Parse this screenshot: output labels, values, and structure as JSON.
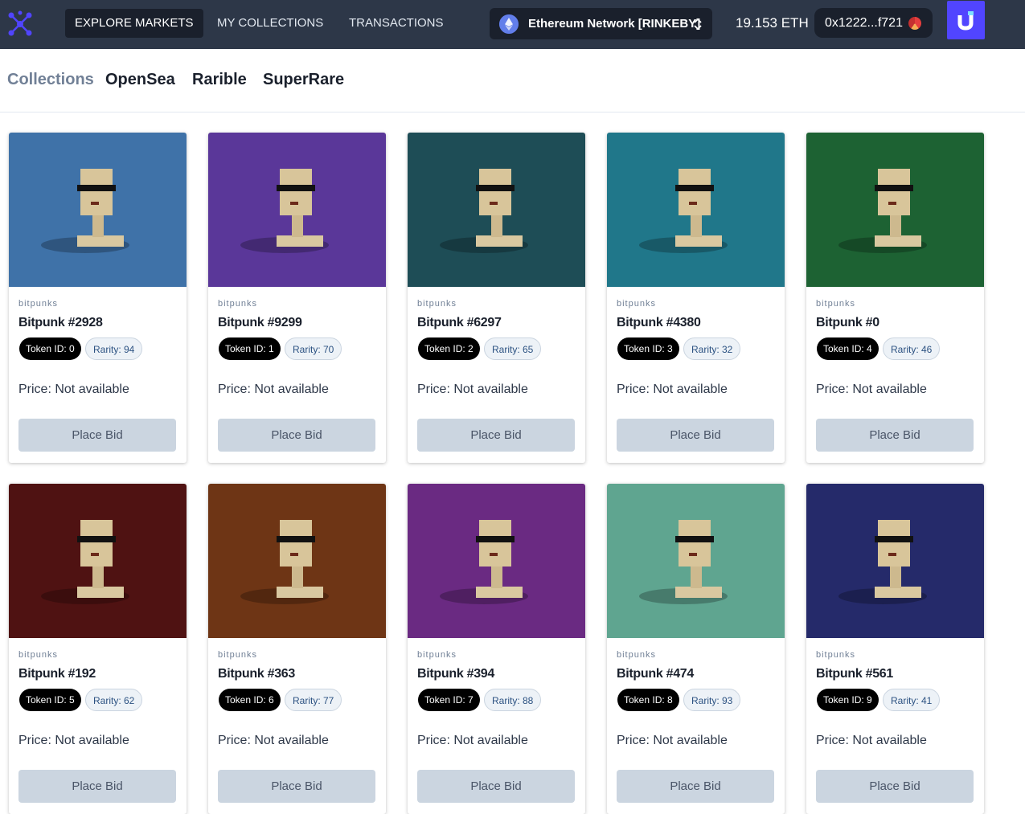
{
  "nav": {
    "links": [
      "EXPLORE MARKETS",
      "MY COLLECTIONS",
      "TRANSACTIONS"
    ],
    "network": "Ethereum Network [RINKEBY]",
    "balance": "19.153 ETH",
    "wallet": "0x1222...f721"
  },
  "tabs": [
    "Collections",
    "OpenSea",
    "Rarible",
    "SuperRare"
  ],
  "colors": {
    "nav_bg": "#2d3748",
    "accent": "#5145ff",
    "card_backgrounds": [
      "#3f72a8",
      "#5a3799",
      "#1e4d56",
      "#20778a",
      "#1d6233",
      "#4f1212",
      "#6e3515",
      "#6a2a82",
      "#5fa590",
      "#252a6a"
    ]
  },
  "cards": [
    {
      "collection": "bitpunks",
      "name": "Bitpunk #2928",
      "token": "Token ID: 0",
      "rarity": "Rarity: 94",
      "price": "Price: Not available",
      "button": "Place Bid"
    },
    {
      "collection": "bitpunks",
      "name": "Bitpunk #9299",
      "token": "Token ID: 1",
      "rarity": "Rarity: 70",
      "price": "Price: Not available",
      "button": "Place Bid"
    },
    {
      "collection": "bitpunks",
      "name": "Bitpunk #6297",
      "token": "Token ID: 2",
      "rarity": "Rarity: 65",
      "price": "Price: Not available",
      "button": "Place Bid"
    },
    {
      "collection": "bitpunks",
      "name": "Bitpunk #4380",
      "token": "Token ID: 3",
      "rarity": "Rarity: 32",
      "price": "Price: Not available",
      "button": "Place Bid"
    },
    {
      "collection": "bitpunks",
      "name": "Bitpunk #0",
      "token": "Token ID: 4",
      "rarity": "Rarity: 46",
      "price": "Price: Not available",
      "button": "Place Bid"
    },
    {
      "collection": "bitpunks",
      "name": "Bitpunk #192",
      "token": "Token ID: 5",
      "rarity": "Rarity: 62",
      "price": "Price: Not available",
      "button": "Place Bid"
    },
    {
      "collection": "bitpunks",
      "name": "Bitpunk #363",
      "token": "Token ID: 6",
      "rarity": "Rarity: 77",
      "price": "Price: Not available",
      "button": "Place Bid"
    },
    {
      "collection": "bitpunks",
      "name": "Bitpunk #394",
      "token": "Token ID: 7",
      "rarity": "Rarity: 88",
      "price": "Price: Not available",
      "button": "Place Bid"
    },
    {
      "collection": "bitpunks",
      "name": "Bitpunk #474",
      "token": "Token ID: 8",
      "rarity": "Rarity: 93",
      "price": "Price: Not available",
      "button": "Place Bid"
    },
    {
      "collection": "bitpunks",
      "name": "Bitpunk #561",
      "token": "Token ID: 9",
      "rarity": "Rarity: 41",
      "price": "Price: Not available",
      "button": "Place Bid"
    }
  ]
}
